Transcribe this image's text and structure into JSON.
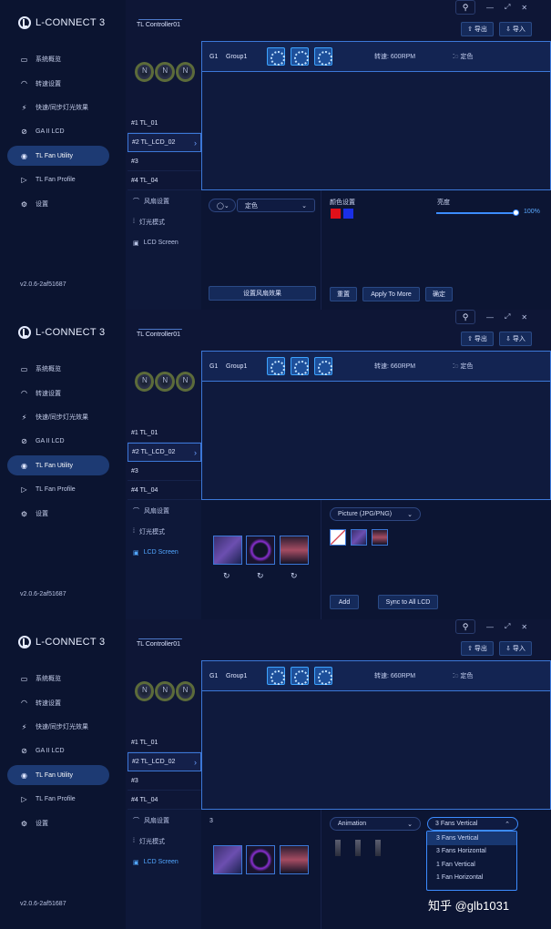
{
  "app": {
    "title": "L-CONNECT 3",
    "version": "v2.0.6-2af51687"
  },
  "nav": [
    {
      "label": "系统概览",
      "icon": "monitor-icon"
    },
    {
      "label": "转速设置",
      "icon": "gauge-icon"
    },
    {
      "label": "快速/同步灯光效果",
      "icon": "lightning-icon"
    },
    {
      "label": "GA II LCD",
      "icon": "lcd-icon"
    },
    {
      "label": "TL Fan Utility",
      "icon": "fan-toggle-icon"
    },
    {
      "label": "TL Fan Profile",
      "icon": "play-icon"
    },
    {
      "label": "设置",
      "icon": "gear-icon"
    }
  ],
  "toolbar": {
    "export_label": "导出",
    "import_label": "导入"
  },
  "controller": {
    "title": "TL Controller01"
  },
  "ports": [
    {
      "label": "#1  TL_01"
    },
    {
      "label": "#2  TL_LCD_02"
    },
    {
      "label": "#3"
    },
    {
      "label": "#4  TL_04"
    }
  ],
  "group": {
    "id": "G1",
    "name": "Group1",
    "mode": "定色"
  },
  "panels": [
    {
      "rpm": "转速: 600RPM"
    },
    {
      "rpm": "转速: 660RPM"
    },
    {
      "rpm": "转速: 660RPM"
    }
  ],
  "bottom_menu": [
    {
      "label": "风扇设置"
    },
    {
      "label": "灯光模式"
    },
    {
      "label": "LCD Screen"
    }
  ],
  "panel1": {
    "mode_select": "定色",
    "color_label": "颜色设置",
    "brightness_label": "亮度",
    "brightness_value": "100%",
    "brightness": 1.0,
    "colors": [
      "#e0101a",
      "#1a2fe6"
    ],
    "apply_fan_button": "设置风扇效果",
    "reset_button": "重置",
    "apply_more_button": "Apply To More",
    "save_button": "确定"
  },
  "panel2": {
    "picture_select": "Picture (JPG/PNG)",
    "add_button": "Add",
    "sync_button": "Sync to All LCD"
  },
  "panel3": {
    "count": "3",
    "animation_select": "Animation",
    "layout_select": "3 Fans Vertical",
    "layout_options": [
      "3 Fans Vertical",
      "3 Fans Horizontal",
      "1 Fan Vertical",
      "1 Fan Horizontal"
    ]
  },
  "watermark": "知乎 @glb1031"
}
